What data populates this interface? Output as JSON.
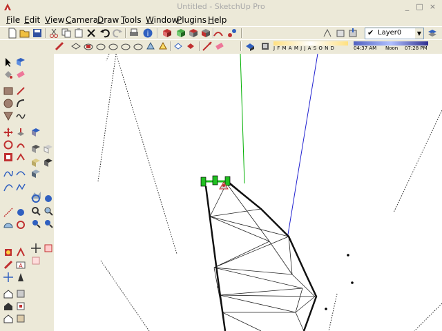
{
  "window": {
    "title": "Untitled - SketchUp Pro",
    "minimize_glyph": "_",
    "maximize_glyph": "□",
    "close_glyph": "×"
  },
  "menu": [
    {
      "label": "File",
      "key": "F"
    },
    {
      "label": "Edit",
      "key": "E"
    },
    {
      "label": "View",
      "key": "V"
    },
    {
      "label": "Camera",
      "key": "C"
    },
    {
      "label": "Draw",
      "key": "D"
    },
    {
      "label": "Tools",
      "key": "T"
    },
    {
      "label": "Window",
      "key": "W"
    },
    {
      "label": "Plugins",
      "key": "P"
    },
    {
      "label": "Help",
      "key": "H"
    }
  ],
  "layers": {
    "current": "Layer0",
    "checked_glyph": "✔",
    "dropdown_glyph": "▼"
  },
  "shadows": {
    "months": "J F M A M J J A S O N D",
    "time_start": "04:37 AM",
    "time_noon": "Noon",
    "time_end": "07:28 PM"
  },
  "colors": {
    "axis_green": "#00b000",
    "axis_blue": "#2020d0",
    "accent_red": "#c0302a",
    "selection_green": "#20c020"
  }
}
